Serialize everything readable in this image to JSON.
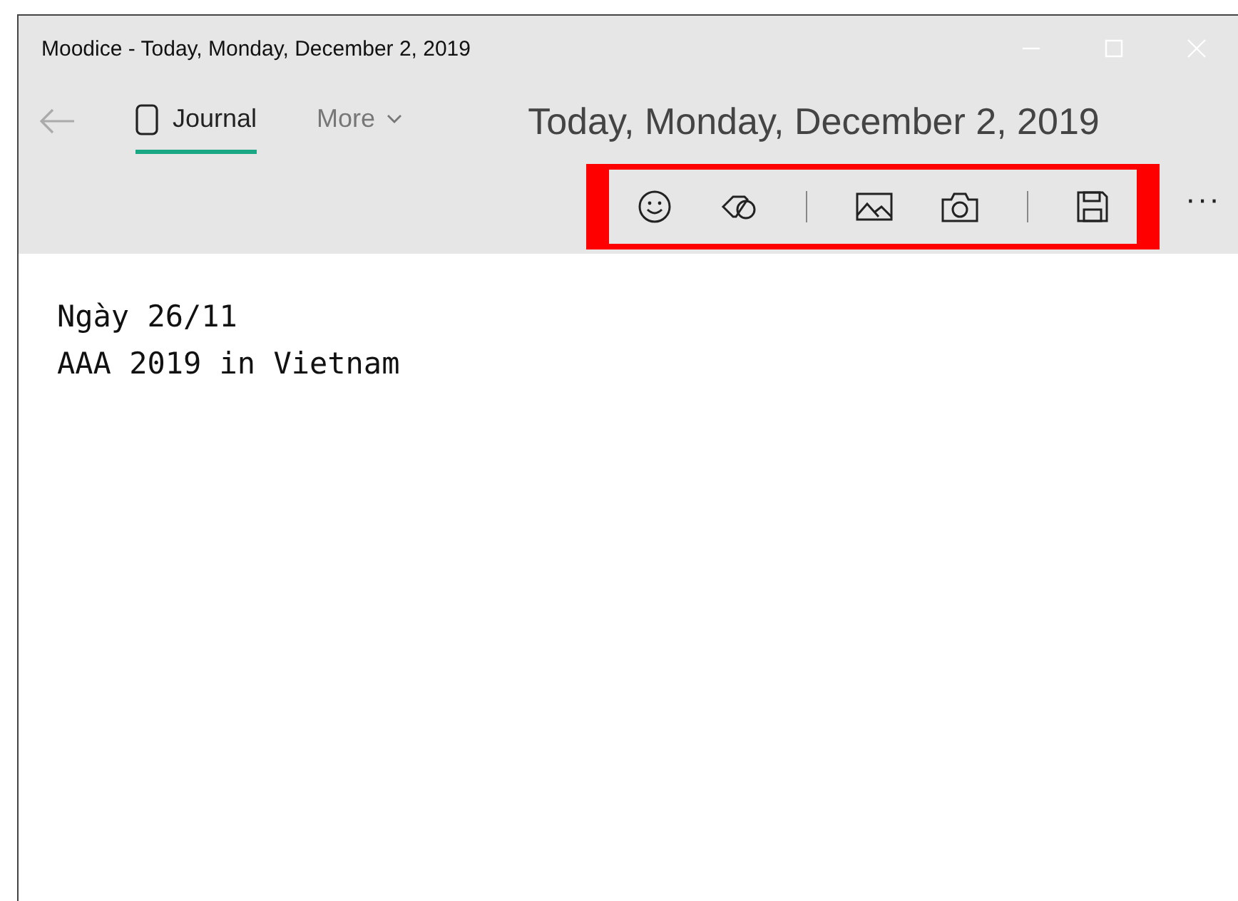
{
  "window": {
    "title": "Moodice - Today, Monday, December 2, 2019"
  },
  "tabs": [
    {
      "label": "Journal",
      "selected": true,
      "kind": "tab"
    },
    {
      "label": "More",
      "selected": false,
      "kind": "menu"
    }
  ],
  "date_heading": "Today, Monday, December 2, 2019",
  "toolbar": {
    "items": [
      {
        "kind": "emoji"
      },
      {
        "kind": "tag"
      },
      {
        "kind": "separator"
      },
      {
        "kind": "image"
      },
      {
        "kind": "camera"
      },
      {
        "kind": "separator"
      },
      {
        "kind": "save"
      }
    ],
    "highlighted": true,
    "more": "···"
  },
  "entry": {
    "lines": [
      "Ngày 26/11",
      "AAA 2019 in Vietnam"
    ]
  }
}
